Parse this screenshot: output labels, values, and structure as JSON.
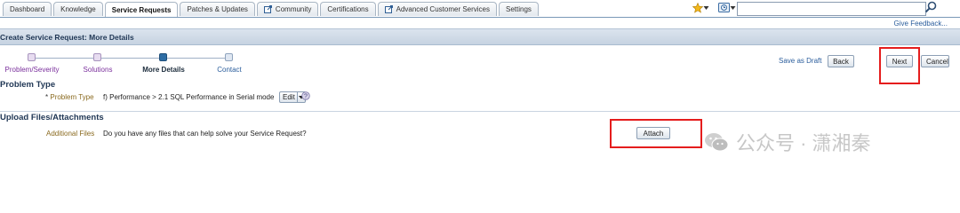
{
  "tabs": [
    {
      "label": "Dashboard",
      "active": false,
      "external": false
    },
    {
      "label": "Knowledge",
      "active": false,
      "external": false
    },
    {
      "label": "Service Requests",
      "active": true,
      "external": false
    },
    {
      "label": "Patches & Updates",
      "active": false,
      "external": false
    },
    {
      "label": "Community",
      "active": false,
      "external": true
    },
    {
      "label": "Certifications",
      "active": false,
      "external": false
    },
    {
      "label": "Advanced Customer Services",
      "active": false,
      "external": true
    },
    {
      "label": "Settings",
      "active": false,
      "external": false
    }
  ],
  "search": {
    "value": "",
    "placeholder": ""
  },
  "feedback_link": "Give Feedback...",
  "page_title": "Create Service Request: More Details",
  "train": [
    {
      "label": "Problem/Severity",
      "state": "visited"
    },
    {
      "label": "Solutions",
      "state": "visited"
    },
    {
      "label": "More Details",
      "state": "current"
    },
    {
      "label": "Contact",
      "state": "todo"
    }
  ],
  "actions": {
    "save_draft": "Save as Draft",
    "back": "Back",
    "next": "Next",
    "cancel": "Cancel"
  },
  "problem_type": {
    "section_title": "Problem Type",
    "required_mark": "*",
    "label": "Problem Type",
    "value": "f) Performance > 2.1 SQL Performance in Serial mode",
    "edit_label": "Edit"
  },
  "upload": {
    "section_title": "Upload Files/Attachments",
    "label": "Additional Files",
    "question": "Do you have any files that can help solve your Service Request?",
    "attach_label": "Attach"
  },
  "watermark": "公众号 · 潇湘秦",
  "colors": {
    "link": "#2a5d9c",
    "visited": "#7a2f9c",
    "label_gold": "#8a6a1f",
    "highlight_red": "#e51d1d"
  },
  "icons": {
    "favorites": "star-icon",
    "recent": "recent-pages-icon",
    "search": "search-icon",
    "help": "help-icon",
    "external": "external-link-icon"
  }
}
